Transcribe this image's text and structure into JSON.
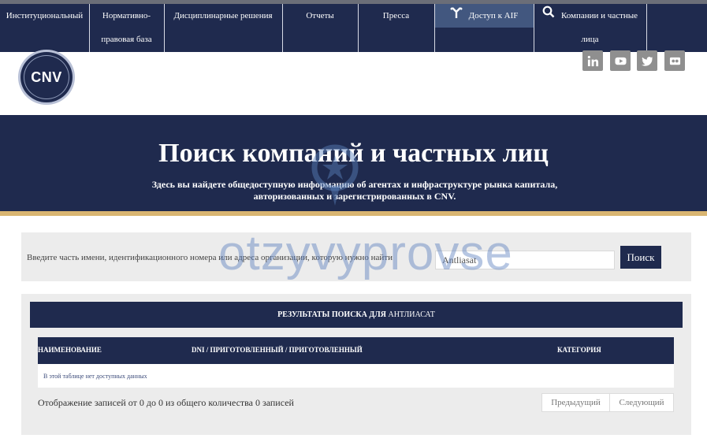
{
  "nav": {
    "items": [
      {
        "label": "Институциональный"
      },
      {
        "label_line1": "Нормативно-",
        "label_line2": "правовая база"
      },
      {
        "label": "Дисциплинарные решения"
      },
      {
        "label": "Отчеты"
      },
      {
        "label": "Пресса"
      },
      {
        "label": "Доступ к AIF",
        "icon": "aif-icon"
      },
      {
        "label_line1": "Компании и частные",
        "label_line2": "лица",
        "icon": "search-icon"
      }
    ]
  },
  "logo": {
    "text": "CNV"
  },
  "social": [
    "linkedin-icon",
    "youtube-icon",
    "twitter-icon",
    "flickr-icon"
  ],
  "hero": {
    "title": "Поиск компаний и частных лиц",
    "subtitle": "Здесь вы найдете общедоступную информацию об агентах и инфраструктуре рынка капитала, авторизованных и зарегистрированных в CNV."
  },
  "search": {
    "label": "Введите часть имени, идентификационного номера или адреса организации, которую нужно найти",
    "value": "Antliasat",
    "button": "Поиск"
  },
  "results": {
    "heading_prefix": "РЕЗУЛЬТАТЫ ПОИСКА ДЛЯ",
    "heading_query": "АНТЛИАСАТ",
    "columns": [
      "НАИМЕНОВАНИЕ",
      "DNI / ПРИГОТОВЛЕННЫЙ / ПРИГОТОВЛЕННЫЙ",
      "КАТЕГОРИЯ"
    ],
    "empty": "В этой таблице нет доступных данных",
    "info": "Отображение записей от 0 до 0 из общего количества 0 записей",
    "prev": "Предыдущий",
    "next": "Следующий"
  },
  "watermark": {
    "text": "otzyvyprovse"
  },
  "colors": {
    "navy": "#1f2a4e",
    "gold": "#d9b571",
    "active_nav": "#42577f",
    "panel": "#ececec"
  }
}
